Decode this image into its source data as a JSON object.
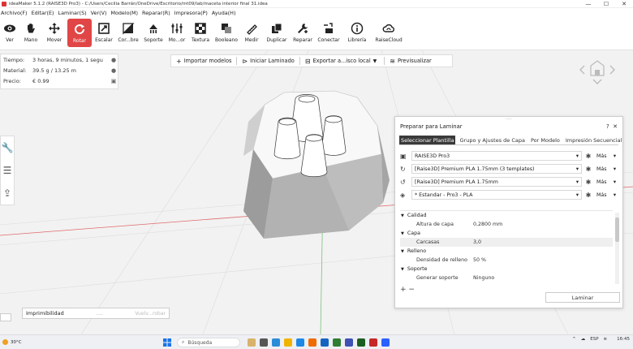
{
  "window": {
    "title": "ideaMaker 5.1.2 (RAISE3D Pro3) - C:/Users/Cecilia Barrán/OneDrive/Escritorio/mt09/lab/maceta interior final 31.idea",
    "minimize": "—",
    "maximize": "☐",
    "close": "✕"
  },
  "menu": [
    "Archivo(F)",
    "Editar(E)",
    "Laminar(S)",
    "Ver(V)",
    "Modelo(M)",
    "Reparar(R)",
    "Impresora(P)",
    "Ayuda(H)"
  ],
  "toolbar": [
    {
      "label": "Ver",
      "icon": "eye-icon"
    },
    {
      "label": "Mano",
      "icon": "hand-icon"
    },
    {
      "label": "Mover",
      "icon": "move-icon"
    },
    {
      "label": "Rotar",
      "icon": "rotate-icon",
      "active": true
    },
    {
      "label": "Escalar",
      "icon": "scale-icon"
    },
    {
      "label": "Cor...bre",
      "icon": "cut-icon"
    },
    {
      "label": "Soporte",
      "icon": "support-icon"
    },
    {
      "label": "Mo...or",
      "icon": "modifier-icon"
    },
    {
      "label": "Textura",
      "icon": "texture-icon"
    },
    {
      "label": "Booleano",
      "icon": "boolean-icon"
    },
    {
      "label": "Medir",
      "icon": "measure-icon"
    },
    {
      "label": "Duplicar",
      "icon": "duplicate-icon"
    },
    {
      "label": "Reparar",
      "icon": "repair-icon"
    },
    {
      "label": "Conectar",
      "icon": "connect-icon"
    },
    {
      "label": "Librería",
      "icon": "library-icon"
    },
    {
      "label": "RaiseCloud",
      "icon": "cloud-icon"
    }
  ],
  "info": {
    "tiempo_label": "Tiempo:",
    "tiempo_value": "3 horas, 9 minutos, 1 segu",
    "material_label": "Material:",
    "material_value": "39.5 g / 13.25 m",
    "precio_label": "Precio:",
    "precio_value": "€ 0.99"
  },
  "actions": {
    "import": "Importar modelos",
    "slice": "Iniciar Laminado",
    "export": "Exportar a...isco local",
    "preview": "Previsualizar"
  },
  "panel": {
    "title": "Preparar para Laminar",
    "help": "?",
    "close": "✕",
    "tabs": [
      "Seleccionar Plantilla",
      "Grupo y Ajustes de Capa",
      "Por Modelo",
      "Impresión Secuencial"
    ],
    "printer": "RAISE3D Pro3",
    "filament1": "[Raise3D] Premium PLA 1.75mm (3 templates)",
    "filament2": "[Raise3D] Premium PLA 1.75mm",
    "profile": "* Estandar - Pro3 - PLA",
    "more": "Más",
    "settings": {
      "calidad": "Calidad",
      "altura_label": "Altura de capa",
      "altura_value": "0,2800 mm",
      "capa": "Capa",
      "carcasas_label": "Carcasas",
      "carcasas_value": "3,0",
      "relleno": "Relleno",
      "densidad_label": "Densidad de relleno",
      "densidad_value": "50 %",
      "soporte": "Soporte",
      "generar_label": "Generar soporte",
      "generar_value": "Ninguno"
    },
    "plus_minus": "+ −",
    "laminar_button": "Laminar"
  },
  "printability": {
    "label": "Imprimibilidad",
    "link": "Vuelv...robar"
  },
  "taskbar": {
    "weather": "30°C",
    "search": "Búsqueda",
    "lang": "ESP",
    "time": "16:45"
  }
}
